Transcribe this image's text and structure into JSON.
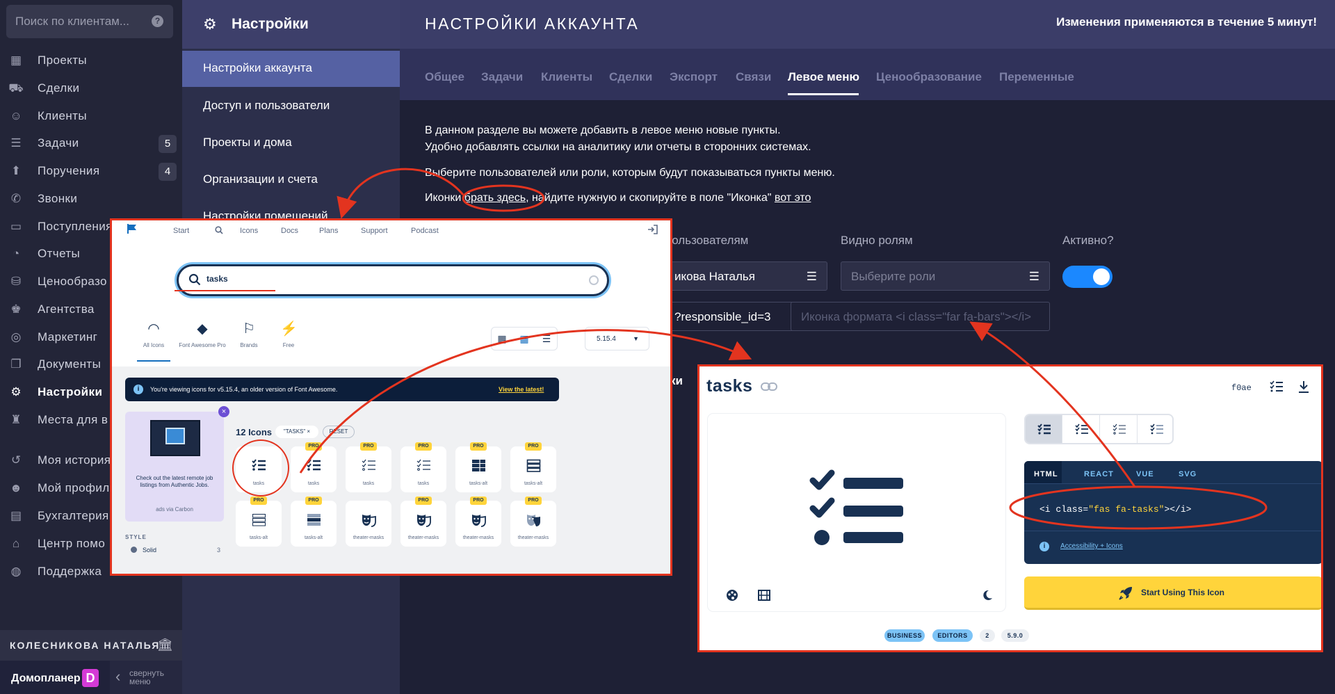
{
  "sidebar": {
    "search_placeholder": "Поиск по клиентам...",
    "help": "?",
    "items": [
      {
        "label": "Проекты",
        "icon": "projects-icon",
        "glyph": "▦"
      },
      {
        "label": "Сделки",
        "icon": "deals-icon",
        "glyph": "⛟"
      },
      {
        "label": "Клиенты",
        "icon": "clients-icon",
        "glyph": "☺"
      },
      {
        "label": "Задачи",
        "icon": "tasks-icon",
        "glyph": "☰",
        "badge": "5"
      },
      {
        "label": "Поручения",
        "icon": "assignments-icon",
        "glyph": "⬆",
        "badge": "4"
      },
      {
        "label": "Звонки",
        "icon": "calls-icon",
        "glyph": "✆"
      },
      {
        "label": "Поступления",
        "icon": "income-icon",
        "glyph": "▭"
      },
      {
        "label": "Отчеты",
        "icon": "reports-icon",
        "glyph": "◔"
      },
      {
        "label": "Ценообразо",
        "icon": "pricing-icon",
        "glyph": "⛁"
      },
      {
        "label": "Агентства",
        "icon": "agencies-icon",
        "glyph": "♚"
      },
      {
        "label": "Маркетинг",
        "icon": "marketing-icon",
        "glyph": "◎"
      },
      {
        "label": "Документы",
        "icon": "documents-icon",
        "glyph": "❐"
      },
      {
        "label": "Настройки",
        "icon": "settings-gear-icon",
        "glyph": "⚙",
        "active": true
      },
      {
        "label": "Места для в",
        "icon": "places-icon",
        "glyph": "♜"
      },
      {
        "label": "Моя история",
        "icon": "history-icon",
        "glyph": "↺"
      },
      {
        "label": "Мой профил",
        "icon": "profile-icon",
        "glyph": "☻"
      },
      {
        "label": "Бухгалтерия",
        "icon": "accounting-icon",
        "glyph": "▤"
      },
      {
        "label": "Центр помо",
        "icon": "help-center-icon",
        "glyph": "⌂"
      },
      {
        "label": "Поддержка",
        "icon": "support-icon",
        "glyph": "◍"
      }
    ],
    "user_name": "КОЛЕСНИКОВА НАТАЛЬЯ",
    "brand_name": "Домопланер",
    "brand_logo": "D",
    "collapse_label": "свернуть меню",
    "collapse_chevron": "‹"
  },
  "settings_sidebar": {
    "title": "Настройки",
    "items": [
      {
        "label": "Настройки аккаунта",
        "active": true
      },
      {
        "label": "Доступ и пользователи"
      },
      {
        "label": "Проекты и дома"
      },
      {
        "label": "Организации и счета"
      },
      {
        "label": "Настройки помещений"
      }
    ]
  },
  "main": {
    "title": "НАСТРОЙКИ АККАУНТА",
    "notice": "Изменения применяются в течение 5 минут!",
    "tabs": [
      "Общее",
      "Задачи",
      "Клиенты",
      "Сделки",
      "Экспорт",
      "Связи",
      "Левое меню",
      "Ценообразование",
      "Переменные"
    ],
    "active_tab": "Левое меню",
    "para1": "В данном разделе вы можете добавить в левое меню новые пункты.",
    "para2": "Удобно добавлять ссылки на аналитику или отчеты в сторонних системах.",
    "para3": "Выберите пользователей или роли, которым будут показываться пункты меню.",
    "para4_prefix": "Иконки ",
    "para4_link1": "брать здесь",
    "para4_mid": ", найдите нужную и скопируйте в поле \"Иконка\" ",
    "para4_link2": "вот это",
    "label_users": "пользователям",
    "label_roles": "Видно ролям",
    "label_active": "Активно?",
    "users_value": "икова Наталья",
    "roles_placeholder": "Выберите роли",
    "url_value": "?responsible_id=3",
    "icon_placeholder": "Иконка формата <i class=\"far fa-bars\"></i>",
    "behind_text": "ки",
    "active": true
  },
  "fa_search_page": {
    "nav": [
      "Start",
      "Icons",
      "Docs",
      "Plans",
      "Support",
      "Podcast"
    ],
    "search_value": "tasks",
    "categories": [
      "All Icons",
      "Font Awesome Pro",
      "Brands",
      "Free"
    ],
    "version": "5.15.4",
    "banner_text": "You're viewing icons for v5.15.4, an older version of Font Awesome.",
    "banner_link": "View the latest!",
    "ad_text": "Check out the latest remote job listings from Authentic Jobs.",
    "ad_via": "ads via Carbon",
    "style_heading": "STYLE",
    "style_solid": "Solid",
    "style_solid_count": "3",
    "result_count": "12 Icons",
    "filter_chip": "\"TASKS\" ×",
    "reset": "RESET",
    "pro_label": "PRO",
    "icons": [
      {
        "name": "tasks",
        "pro": false,
        "kind": "tasks"
      },
      {
        "name": "tasks",
        "pro": true,
        "kind": "tasks"
      },
      {
        "name": "tasks",
        "pro": true,
        "kind": "tasks-light"
      },
      {
        "name": "tasks",
        "pro": true,
        "kind": "tasks-light"
      },
      {
        "name": "tasks-alt",
        "pro": true,
        "kind": "tasks-alt"
      },
      {
        "name": "tasks-alt",
        "pro": true,
        "kind": "tasks-alt-r"
      },
      {
        "name": "tasks-alt",
        "pro": true,
        "kind": "tasks-alt-l"
      },
      {
        "name": "tasks-alt",
        "pro": true,
        "kind": "tasks-alt-d"
      },
      {
        "name": "theater-masks",
        "pro": false,
        "kind": "masks"
      },
      {
        "name": "theater-masks",
        "pro": true,
        "kind": "masks"
      },
      {
        "name": "theater-masks",
        "pro": true,
        "kind": "masks"
      },
      {
        "name": "theater-masks",
        "pro": true,
        "kind": "masks-d"
      }
    ]
  },
  "fa_icon_page": {
    "title": "tasks",
    "unicode": "f0ae",
    "code_tabs": [
      "HTML",
      "REACT",
      "VUE",
      "SVG"
    ],
    "snippet_plain1": "<i class=",
    "snippet_value": "\"fas fa-tasks\"",
    "snippet_plain2": "></i>",
    "accessibility": "Accessibility + Icons",
    "cta": "Start Using This Icon",
    "badges": [
      "BUSINESS",
      "EDITORS",
      "2",
      "5.9.0"
    ]
  }
}
